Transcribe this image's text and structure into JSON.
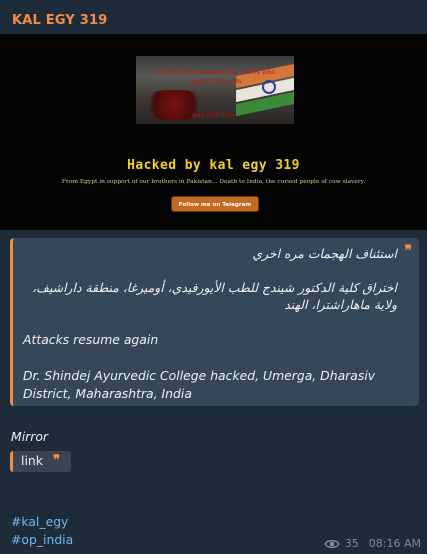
{
  "channel": {
    "name": "KAL EGY 319"
  },
  "preview": {
    "banner_line1": "Death to the damned cow slaves who",
    "banner_line2": "support Zionists",
    "banner_tag": "KAL EGY 319",
    "title": "Hacked by kal egy 319",
    "subtitle": "From Egypt in support of our brothers in Pakistan... Death to India, the cursed people of cow slavery.",
    "button": "Follow me on Telegram"
  },
  "quote": {
    "line_ar1": "استئناف الهجمات مره اخري",
    "line_ar2": "اختراق كلية الدكتور شيندج للطب الأيورفيدي، أوميرغا، منطقة داراشيف، ولاية ماهاراشترا، الهند",
    "line_en1": "Attacks resume again",
    "line_en2": "Dr. Shindej Ayurvedic College hacked, Umerga, Dharasiv District, Maharashtra, India"
  },
  "mirror_label": "Mirror",
  "link": {
    "label": "link"
  },
  "hashtags": [
    "#kal_egy",
    "#op_india"
  ],
  "meta": {
    "views": "35",
    "time": "08:16 AM"
  },
  "colors": {
    "accent": "#f28c48",
    "background": "#1e2c3a",
    "hashtag": "#72b4ee",
    "quote_bg": "#36475a"
  },
  "icons": {
    "views": "eye-icon",
    "quote": "quote-icon"
  }
}
